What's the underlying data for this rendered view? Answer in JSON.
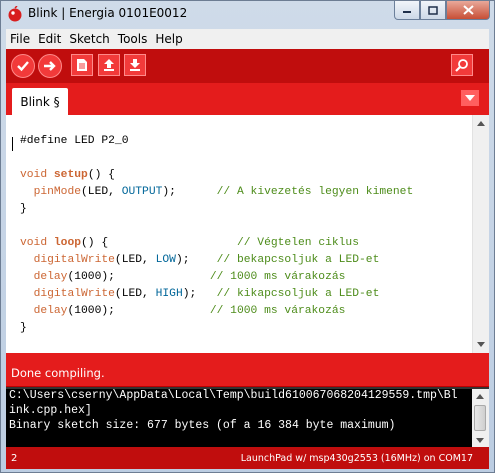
{
  "window": {
    "title": "Blink | Energia 0101E0012"
  },
  "menu": {
    "items": [
      "File",
      "Edit",
      "Sketch",
      "Tools",
      "Help"
    ]
  },
  "toolbar": {
    "buttons": [
      "verify-icon",
      "upload-icon",
      "new-icon",
      "open-icon",
      "save-icon",
      "serial-monitor-icon"
    ]
  },
  "tabs": {
    "active": "Blink §"
  },
  "code": {
    "lines": [
      [
        {
          "t": "#define LED P2_0",
          "c": "pp"
        }
      ],
      [],
      [
        {
          "t": "void ",
          "c": "kw"
        },
        {
          "t": "setup",
          "c": "fn-b"
        },
        {
          "t": "() {",
          "c": ""
        }
      ],
      [
        {
          "t": "  ",
          "c": ""
        },
        {
          "t": "pinMode",
          "c": "fn"
        },
        {
          "t": "(LED, ",
          "c": ""
        },
        {
          "t": "OUTPUT",
          "c": "const"
        },
        {
          "t": ");      ",
          "c": ""
        },
        {
          "t": "// A kivezetés legyen kimenet",
          "c": "cm"
        }
      ],
      [
        {
          "t": "}",
          "c": ""
        }
      ],
      [],
      [
        {
          "t": "void ",
          "c": "kw"
        },
        {
          "t": "loop",
          "c": "fn-b"
        },
        {
          "t": "() {                   ",
          "c": ""
        },
        {
          "t": "// Végtelen ciklus",
          "c": "cm"
        }
      ],
      [
        {
          "t": "  ",
          "c": ""
        },
        {
          "t": "digitalWrite",
          "c": "fn"
        },
        {
          "t": "(LED, ",
          "c": ""
        },
        {
          "t": "LOW",
          "c": "const"
        },
        {
          "t": ");    ",
          "c": ""
        },
        {
          "t": "// bekapcsoljuk a LED-et",
          "c": "cm"
        }
      ],
      [
        {
          "t": "  ",
          "c": ""
        },
        {
          "t": "delay",
          "c": "fn"
        },
        {
          "t": "(1000);              ",
          "c": ""
        },
        {
          "t": "// 1000 ms várakozás",
          "c": "cm"
        }
      ],
      [
        {
          "t": "  ",
          "c": ""
        },
        {
          "t": "digitalWrite",
          "c": "fn"
        },
        {
          "t": "(LED, ",
          "c": ""
        },
        {
          "t": "HIGH",
          "c": "const"
        },
        {
          "t": ");   ",
          "c": ""
        },
        {
          "t": "// kikapcsoljuk a LED-et",
          "c": "cm"
        }
      ],
      [
        {
          "t": "  ",
          "c": ""
        },
        {
          "t": "delay",
          "c": "fn"
        },
        {
          "t": "(1000);              ",
          "c": ""
        },
        {
          "t": "// 1000 ms várakozás",
          "c": "cm"
        }
      ],
      [
        {
          "t": "}",
          "c": ""
        }
      ]
    ]
  },
  "status": {
    "message": "Done compiling."
  },
  "console": {
    "lines": [
      "C:\\Users\\cserny\\AppData\\Local\\Temp\\build610067068204129559.tmp\\Bl",
      "ink.cpp.hex]",
      "Binary sketch size: 677 bytes (of a 16 384 byte maximum)"
    ]
  },
  "footer": {
    "line_number": "2",
    "board": "LaunchPad w/ msp430g2553 (16MHz) on COM17"
  },
  "colors": {
    "toolbar": "#c00d0d",
    "tabstrip": "#e41c1c",
    "keyword": "#cc6633",
    "constant": "#006699",
    "comment": "#4d8c1a"
  }
}
